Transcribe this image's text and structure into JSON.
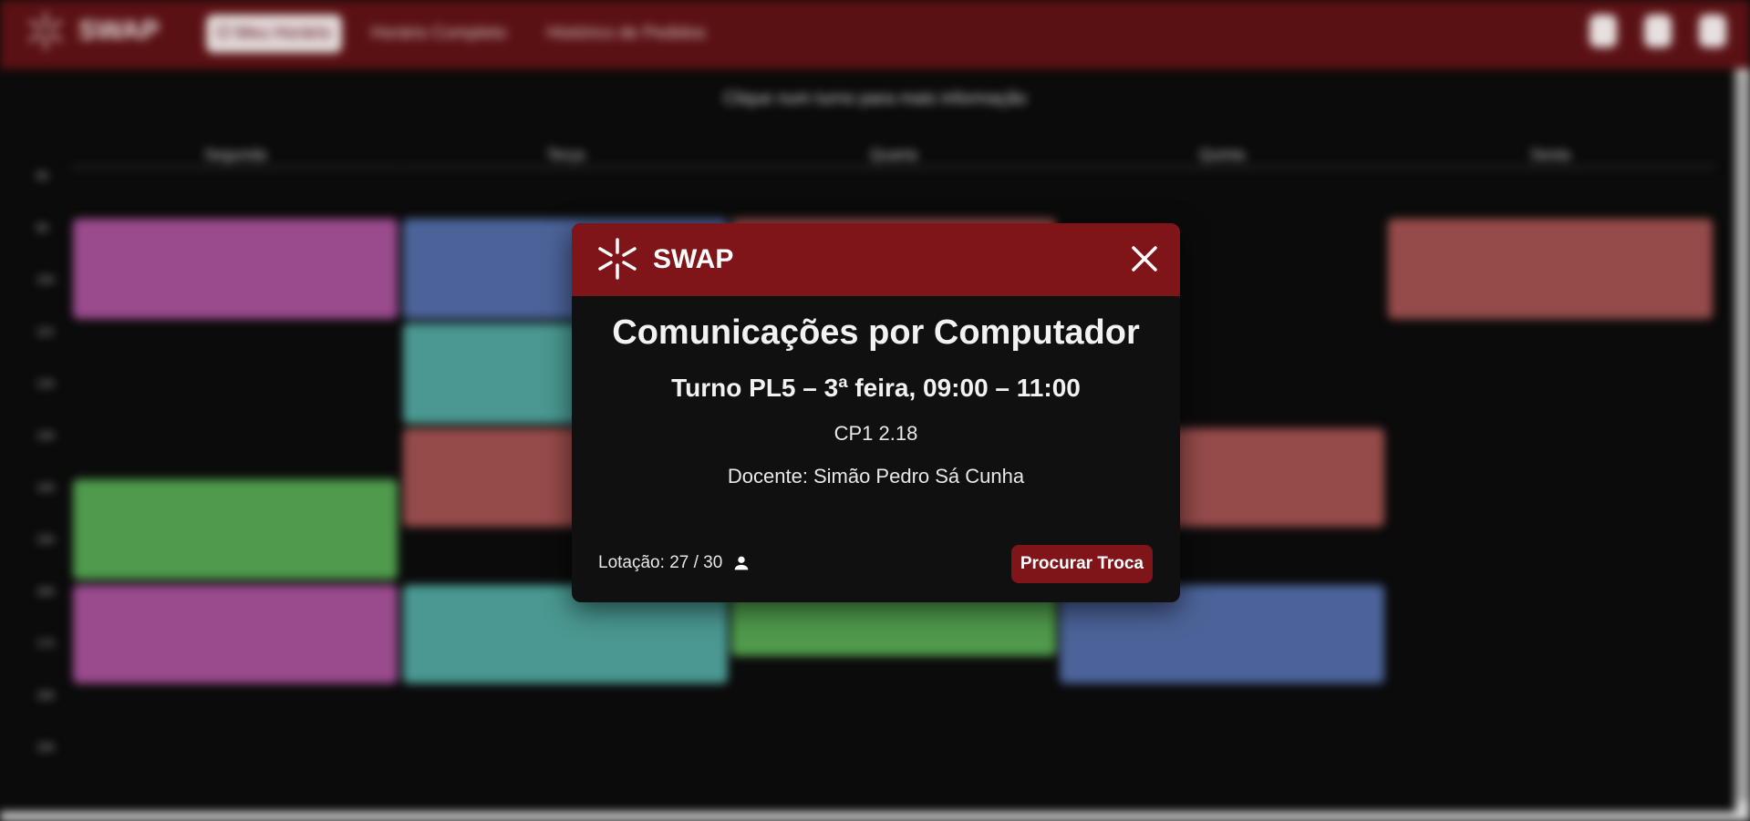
{
  "app": {
    "brand": "SWAP",
    "nav": [
      {
        "label": "O Meu Horário",
        "active": true
      },
      {
        "label": "Horário Completo",
        "active": false
      },
      {
        "label": "Histórico de Pedidos",
        "active": false
      }
    ],
    "hint": "Clique num turno para mais informação",
    "days": [
      "Segunda",
      "Terça",
      "Quarta",
      "Quinta",
      "Sexta"
    ],
    "times": [
      "8h",
      "9h",
      "10h",
      "11h",
      "12h",
      "13h",
      "14h",
      "15h",
      "16h",
      "17h",
      "18h",
      "19h"
    ],
    "blocks_colors": {
      "purple": "#9a4b8d",
      "blue": "#4c6399",
      "teal": "#4a9891",
      "red": "#954b4a",
      "green": "#4f9a4c"
    }
  },
  "modal": {
    "header": "SWAP",
    "course": "Comunicações por Computador",
    "shift": "Turno PL5 – 3ª feira, 09:00 – 11:00",
    "room": "CP1 2.18",
    "teacher_label": "Docente:",
    "teacher": "Simão Pedro Sá Cunha",
    "capacity_label": "Lotação:",
    "capacity": "27 / 30",
    "action": "Procurar Troca",
    "colors": {
      "accent": "#7f1519",
      "background": "#101010"
    }
  }
}
